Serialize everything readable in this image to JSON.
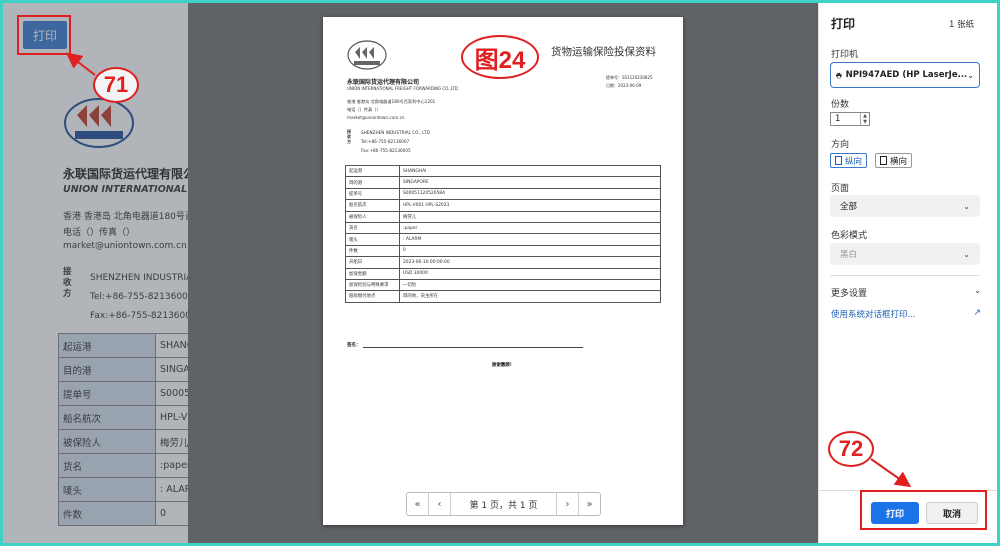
{
  "underlying": {
    "print_button": "打印",
    "company_cn": "永联国际货运代理有限公",
    "company_en": "UNION INTERNATIONAL FREIGHT",
    "address": "香港 香港岛 北角电器道180号百站",
    "phone_fax": "电话（）传真（）",
    "email": "market@uniontown.com.cn",
    "receiver_label": "接收方",
    "receiver_lines": [
      "SHENZHEN INDUSTRIAL",
      "Tel:+86-755-82136007",
      "Fax:+86-755-82136005"
    ],
    "rows": [
      {
        "k": "起运港",
        "v": "SHANC"
      },
      {
        "k": "目的港",
        "v": "SINGA"
      },
      {
        "k": "提单号",
        "v": "S0005"
      },
      {
        "k": "船名航次",
        "v": "HPL-V"
      },
      {
        "k": "被保险人",
        "v": "梅劳儿"
      },
      {
        "k": "货名",
        "v": ":paper"
      },
      {
        "k": "唛头",
        "v": ": ALAR"
      },
      {
        "k": "件数",
        "v": "0"
      }
    ]
  },
  "preview": {
    "doc_title": "货物运输保险投保资料",
    "company_cn": "永联国际货运代理有限公司",
    "company_en": "UNION INTERNATIONAL FREIGHT FORWARDING CO.,LTD",
    "meta_lines": [
      "提单号：SS1120230825",
      "日期：2023-06-09"
    ],
    "address": "香港 香港岛 北角电器道180号百家利中心1201",
    "phone_fax": "电话（）传真（）",
    "email": "market@uniontown.com.cn",
    "receiver_label": "接收方",
    "receiver_lines": [
      "SHENZHEN INDUSTRIAL CO., LTD",
      "Tel:+86-755-82136007",
      "Fax:+86-755-82136005"
    ],
    "rows": [
      {
        "k": "起运港",
        "v": "SHANGHAI"
      },
      {
        "k": "目的港",
        "v": "SINGAPORE"
      },
      {
        "k": "提单号",
        "v": "S0005112052658A"
      },
      {
        "k": "船名航次",
        "v": "HPL-V001 HPL-S2023"
      },
      {
        "k": "被保险人",
        "v": "梅劳儿"
      },
      {
        "k": "货名",
        "v": ":paper"
      },
      {
        "k": "唛头",
        "v": ": ALARM"
      },
      {
        "k": "件数",
        "v": "0"
      },
      {
        "k": "开船日",
        "v": "2023-06-10 00:00:00"
      },
      {
        "k": "加保金额",
        "v": "USD 30000"
      },
      {
        "k": "加保险别与特殊要求",
        "v": "一切险"
      },
      {
        "k": "赔款偿付地点",
        "v": "目的地，货主所在"
      }
    ],
    "signature_label": "签名：",
    "thanks": "谢谢惠顾！",
    "pager": {
      "text": "第 1 页，共 1 页",
      "first": "«",
      "prev": "‹",
      "next": "›",
      "last": "»"
    }
  },
  "panel": {
    "title": "打印",
    "sheet_count": "1 张纸",
    "printer_label": "打印机",
    "printer_value": "NPI947AED (HP LaserJe...",
    "copies_label": "份数",
    "copies_value": "1",
    "orientation_label": "方向",
    "portrait": "纵向",
    "landscape": "横向",
    "pages_label": "页面",
    "pages_value": "全部",
    "color_label": "色彩模式",
    "color_value": "黑白",
    "more_settings": "更多设置",
    "system_dialog": "使用系统对话框打印...",
    "print_button": "打印",
    "cancel_button": "取消"
  },
  "annotations": {
    "n71": "71",
    "n72": "72",
    "figure": "图24"
  },
  "colors": {
    "accent": "#1a73e8",
    "annotation": "#e02020",
    "frame": "#3fd0c8"
  }
}
